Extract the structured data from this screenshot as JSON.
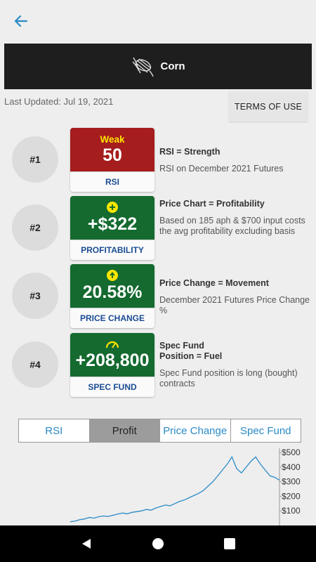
{
  "header": {
    "title": "Corn"
  },
  "last_updated": "Last Updated: Jul 19, 2021",
  "terms_label": "TERMS OF USE",
  "metrics": [
    {
      "rank": "#1",
      "status": "Weak",
      "value": "50",
      "label": "RSI",
      "color": "#a51d1d",
      "desc_title": "RSI = Strength",
      "desc_text": "RSI on December 2021 Futures"
    },
    {
      "rank": "#2",
      "value": "+$322",
      "label": "PROFITABILITY",
      "color": "#146a2f",
      "icon": "plus-icon",
      "desc_title": "Price Chart = Profitability",
      "desc_text": "Based on 185 aph & $700 input costs the avg profitability excluding basis"
    },
    {
      "rank": "#3",
      "value": "20.58%",
      "label": "PRICE CHANGE",
      "color": "#146a2f",
      "icon": "arrow-up-icon",
      "desc_title": "Price Change = Movement",
      "desc_text": "December 2021 Futures Price Change %"
    },
    {
      "rank": "#4",
      "value": "+208,800",
      "label": "SPEC FUND",
      "color": "#146a2f",
      "icon": "gauge-icon",
      "desc_title": "Spec Fund\nPosition = Fuel",
      "desc_text": "Spec Fund position is long (bought) contracts"
    }
  ],
  "tabs": [
    "RSI",
    "Profit",
    "Price Change",
    "Spec Fund"
  ],
  "active_tab": "Profit",
  "chart_data": {
    "type": "line",
    "y_ticks": [
      "$500",
      "$400",
      "$300",
      "$200",
      "$100"
    ],
    "ylim": [
      0,
      520
    ],
    "series": [
      {
        "values": [
          25,
          30,
          40,
          45,
          55,
          50,
          60,
          65,
          62,
          70,
          78,
          85,
          80,
          90,
          95,
          100,
          110,
          105,
          120,
          130,
          140,
          135,
          150,
          165,
          175,
          190,
          205,
          220,
          240,
          270,
          300,
          340,
          380,
          420,
          470,
          390,
          360,
          400,
          440,
          470,
          420,
          380,
          340,
          330,
          310
        ]
      }
    ]
  },
  "colors": {
    "accent": "#2a8ac7",
    "card_label": "#1a4c93",
    "line": "#2a8ac7"
  }
}
